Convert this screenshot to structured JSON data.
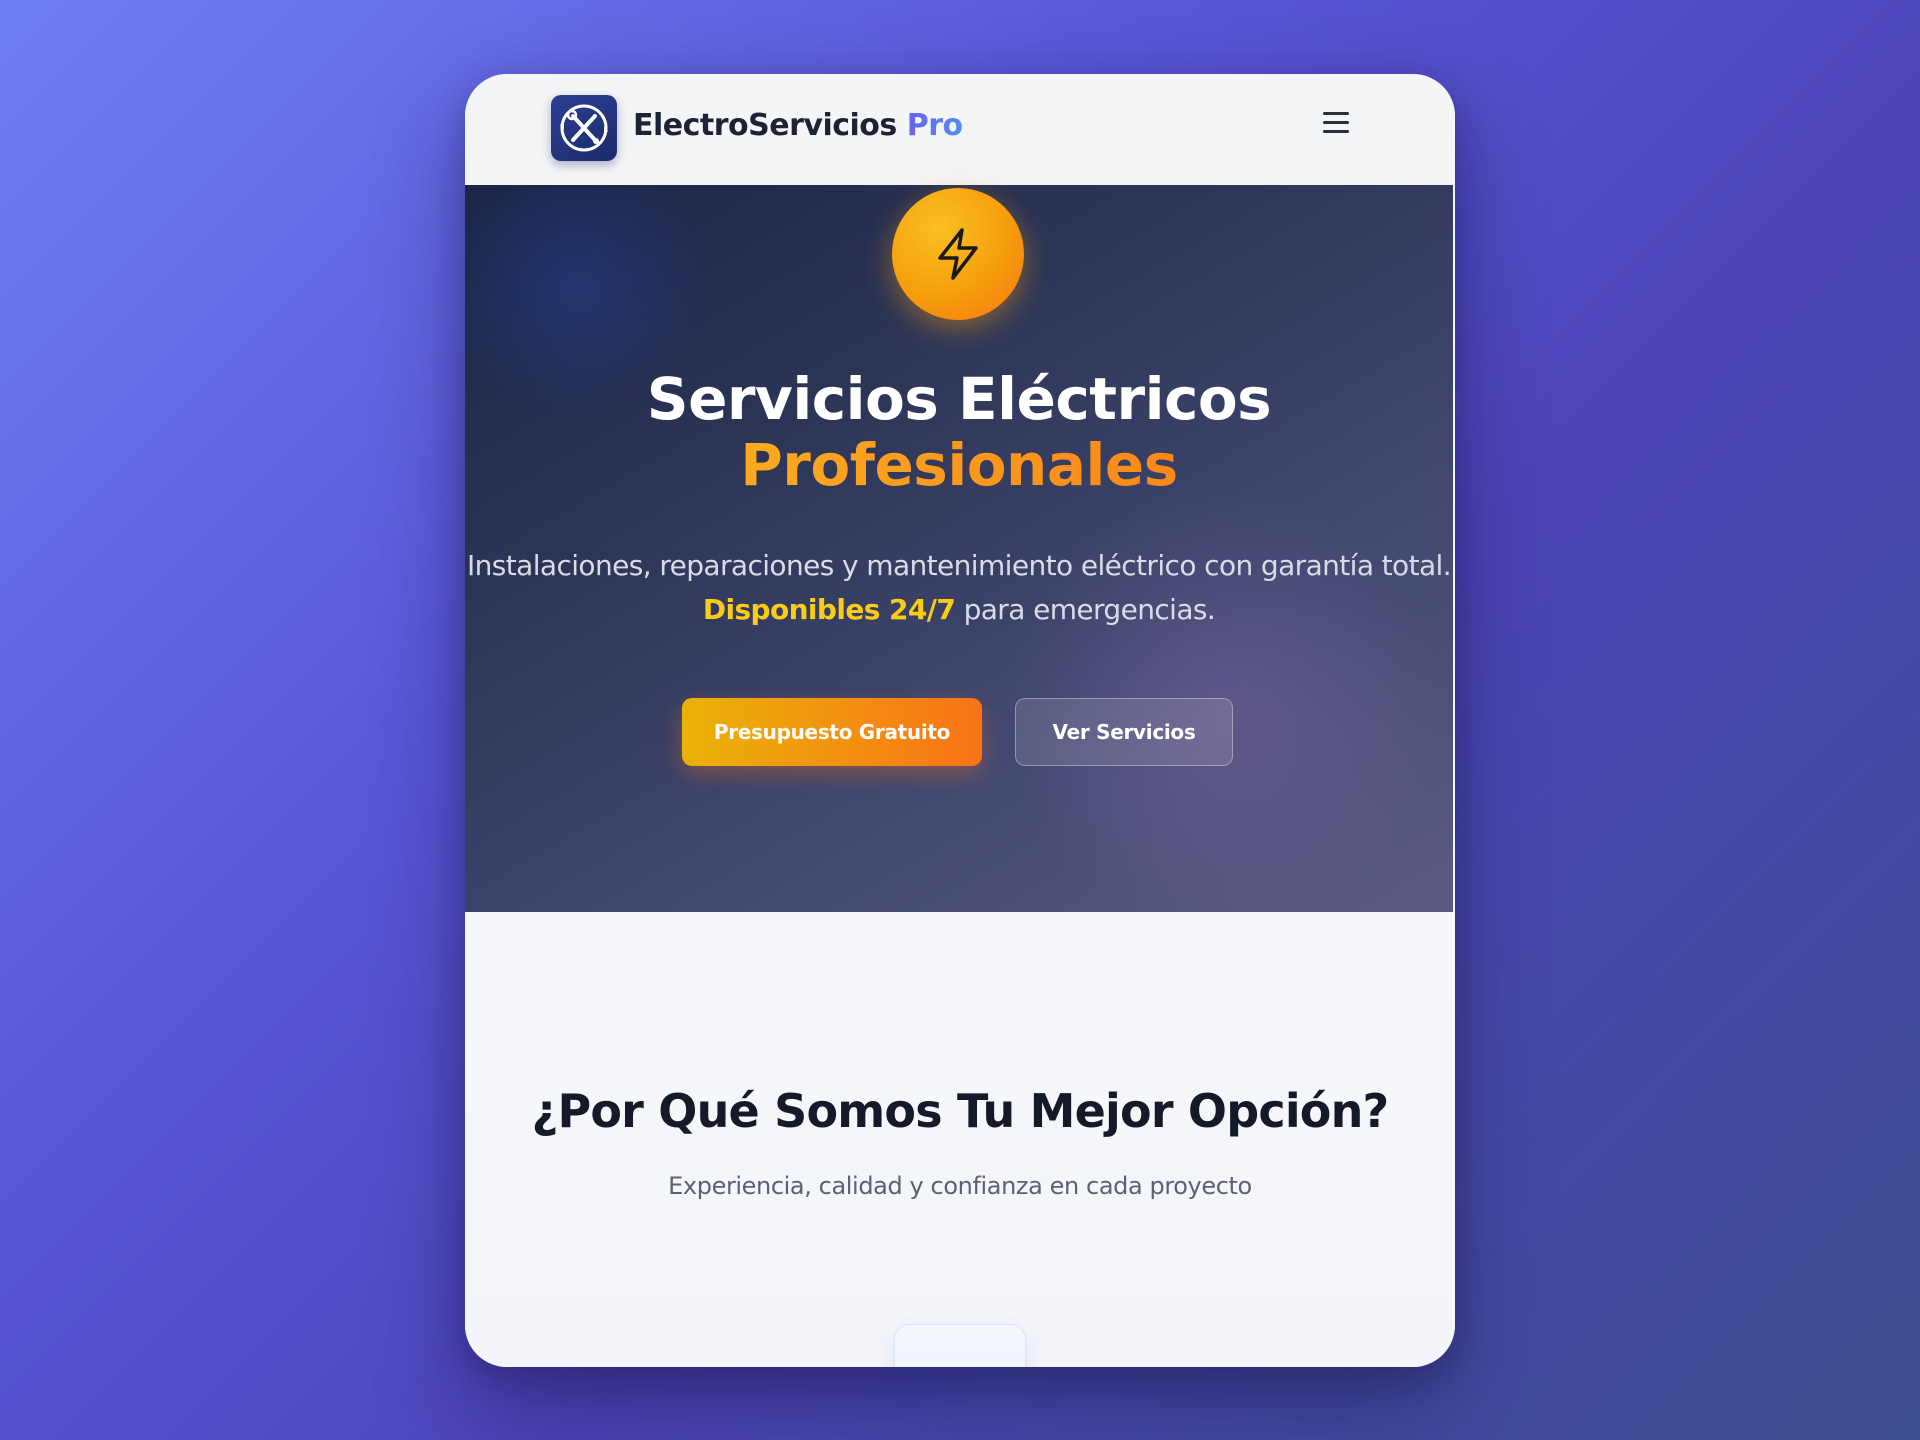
{
  "header": {
    "brand_main": "ElectroServicios",
    "brand_accent": "Pro",
    "logo_icon": "tools-icon",
    "menu_icon": "hamburger-menu-icon"
  },
  "hero": {
    "icon": "lightning-bolt-icon",
    "title_line1": "Servicios Eléctricos",
    "title_line2": "Profesionales",
    "desc_part1": "Instalaciones, reparaciones y mantenimiento eléctrico con garantía total.",
    "desc_highlight": "Disponibles 24/7",
    "desc_part2": "para emergencias.",
    "primary_button": "Presupuesto Gratuito",
    "secondary_button": "Ver Servicios"
  },
  "features": {
    "title": "¿Por Qué Somos Tu Mejor Opción?",
    "subtitle": "Experiencia, calidad y confianza en cada proyecto",
    "card_icon": "checkmark-icon",
    "card_glyph": "✓"
  },
  "colors": {
    "accent_orange": "#f97316",
    "accent_yellow": "#facc15",
    "brand_accent": "#6c63f0",
    "hero_bg": "#2e3658",
    "check_blue": "#2f6fe6"
  }
}
